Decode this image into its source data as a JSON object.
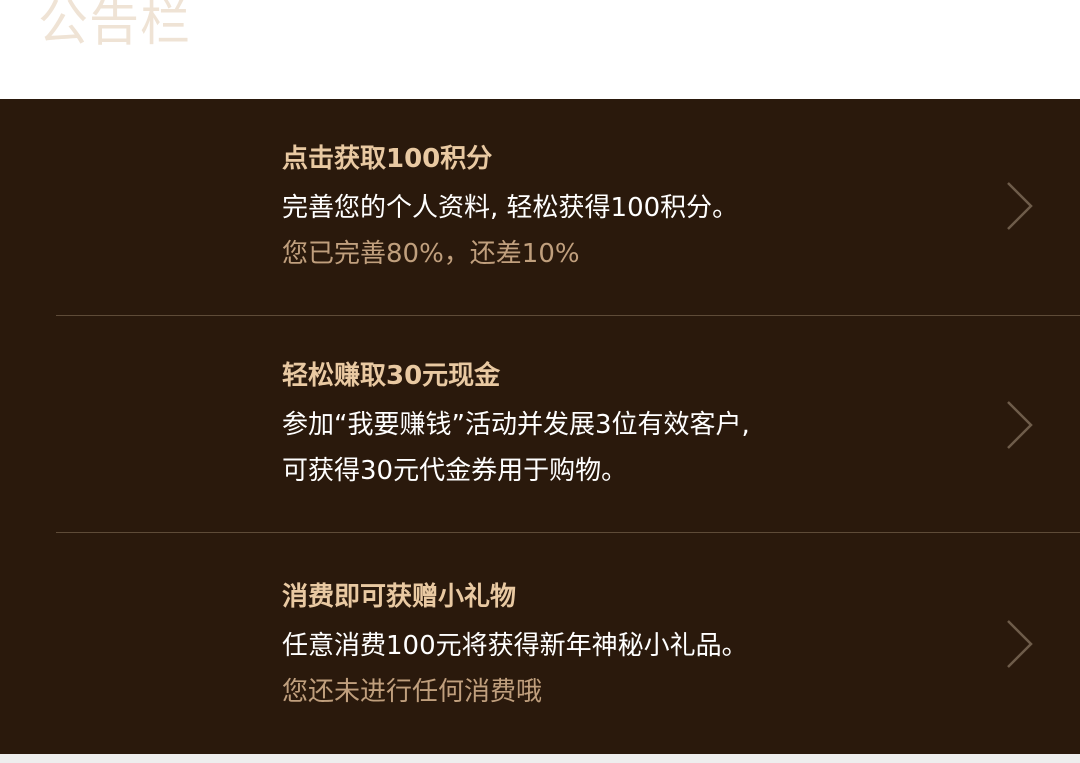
{
  "header": {
    "title": "公告栏"
  },
  "items": [
    {
      "title": "点击获取100积分",
      "description_lines": [
        "完善您的个人资料, 轻松获得100积分。"
      ],
      "status": "您已完善80%，还差10%"
    },
    {
      "title": "轻松赚取30元现金",
      "description_lines": [
        "参加“我要赚钱”活动并发展3位有效客户,",
        "可获得30元代金券用于购物。"
      ],
      "status": ""
    },
    {
      "title": "消费即可获赠小礼物",
      "description_lines": [
        "任意消费100元将获得新年神秘小礼品。"
      ],
      "status": "您还未进行任何消费哦"
    }
  ],
  "icons": {
    "arrow": "chevron-right-icon"
  },
  "colors": {
    "panel_background": "#2a190c",
    "title_text": "#e9c9a2",
    "status_text": "#c09f7d",
    "header_title": "#efe3d5",
    "chevron": "#6e5c4a"
  }
}
